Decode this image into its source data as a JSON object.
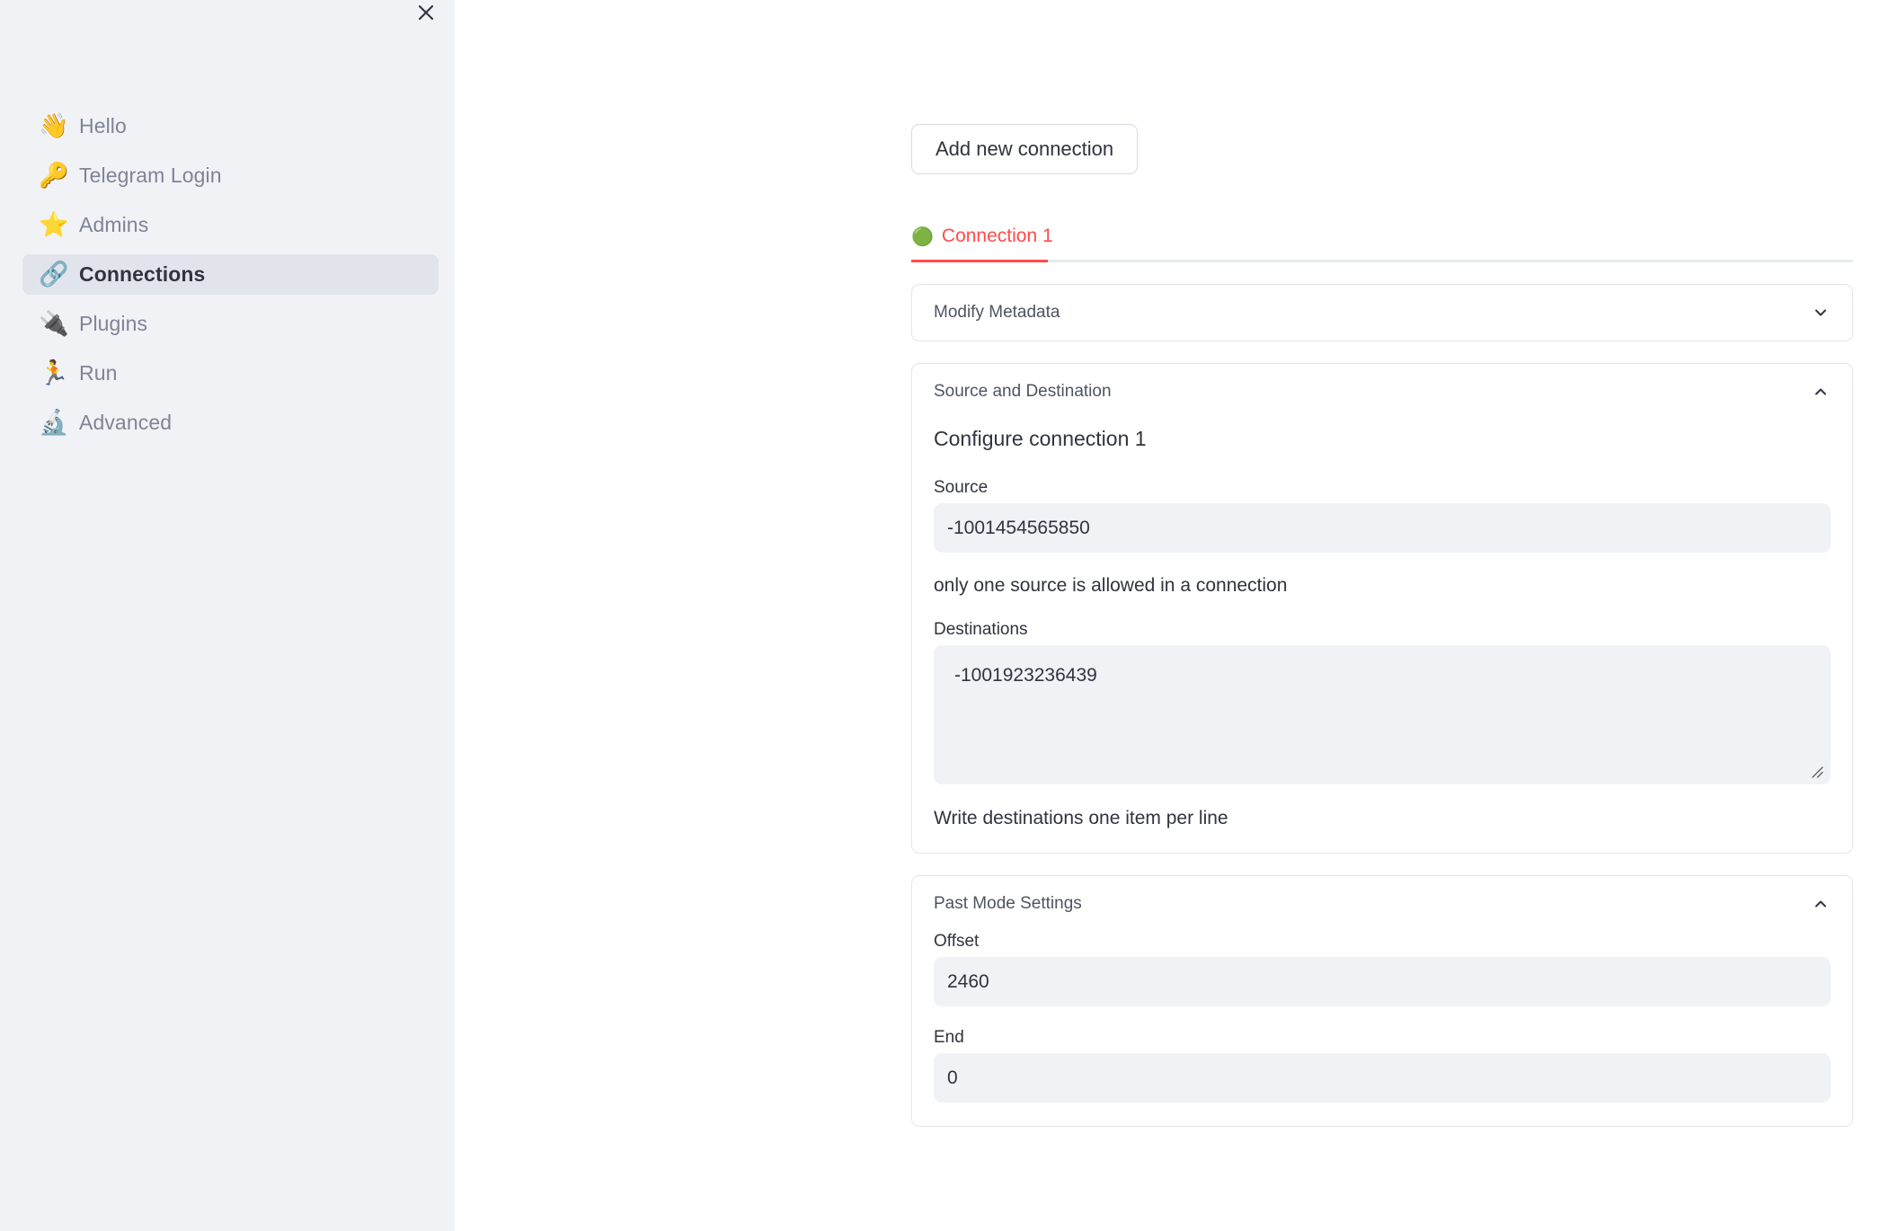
{
  "sidebar": {
    "close_icon": "close-icon",
    "items": [
      {
        "emoji": "👋",
        "icon_name": "waving-hand-icon",
        "label": "Hello",
        "selected": false
      },
      {
        "emoji": "🔑",
        "icon_name": "key-icon",
        "label": "Telegram Login",
        "selected": false
      },
      {
        "emoji": "⭐",
        "icon_name": "star-icon",
        "label": "Admins",
        "selected": false
      },
      {
        "emoji": "🔗",
        "icon_name": "link-icon",
        "label": "Connections",
        "selected": true
      },
      {
        "emoji": "🔌",
        "icon_name": "plug-icon",
        "label": "Plugins",
        "selected": false
      },
      {
        "emoji": "🏃",
        "icon_name": "runner-icon",
        "label": "Run",
        "selected": false
      },
      {
        "emoji": "🔬",
        "icon_name": "microscope-icon",
        "label": "Advanced",
        "selected": false
      }
    ]
  },
  "main": {
    "add_connection_label": "Add new connection",
    "tabs": [
      {
        "status_emoji": "🟢",
        "label": "Connection 1",
        "active": true
      }
    ],
    "panels": {
      "metadata": {
        "title": "Modify Metadata",
        "expanded": false,
        "chevron": "chevron-down-icon"
      },
      "source_destination": {
        "title": "Source and Destination",
        "expanded": true,
        "chevron": "chevron-up-icon",
        "section_title": "Configure connection 1",
        "source_label": "Source",
        "source_value": "-1001454565850",
        "source_helper": "only one source is allowed in a connection",
        "destinations_label": "Destinations",
        "destinations_value": "-1001923236439",
        "destinations_helper": "Write destinations one item per line"
      },
      "past_mode": {
        "title": "Past Mode Settings",
        "expanded": true,
        "chevron": "chevron-up-icon",
        "offset_label": "Offset",
        "offset_value": "2460",
        "end_label": "End",
        "end_value": "0"
      }
    }
  },
  "colors": {
    "accent": "#ff4b4b",
    "sidebar_bg": "#f0f2f6",
    "selected_bg": "#e1e5eb",
    "text_primary": "#31333f",
    "text_muted": "#808495",
    "border": "#e2e5ea",
    "input_bg": "#f0f2f6"
  }
}
